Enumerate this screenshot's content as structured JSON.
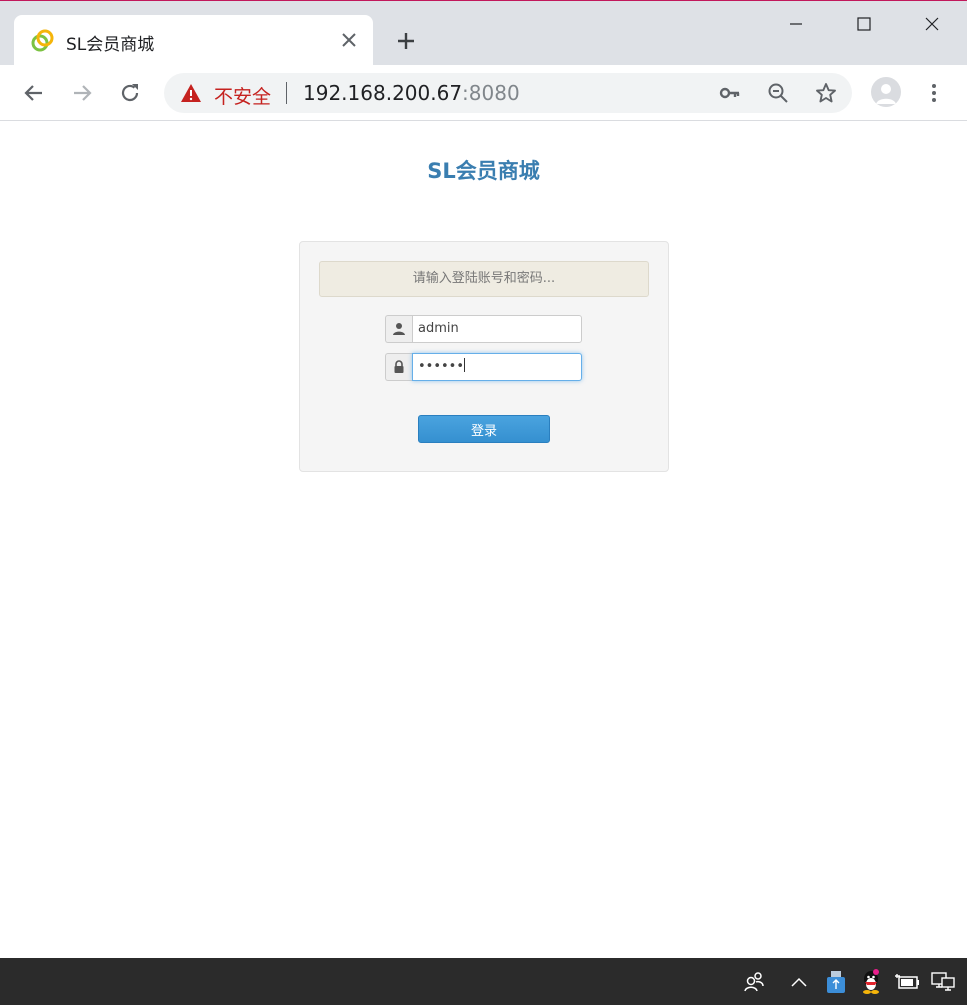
{
  "browser": {
    "tab": {
      "title": "SL会员商城",
      "favicon": "site-favicon-icon"
    },
    "address_bar": {
      "security_label": "不安全",
      "url_host": "192.168.200.67",
      "url_port": ":8080"
    },
    "icons": [
      "back-arrow-icon",
      "forward-arrow-icon",
      "reload-icon",
      "warning-icon",
      "key-icon",
      "zoom-out-icon",
      "star-icon",
      "avatar-icon",
      "more-vert-icon",
      "close-icon",
      "plus-icon",
      "minimize-icon",
      "maximize-icon"
    ],
    "colors": {
      "tabstrip": "#dee1e6",
      "insecure_red": "#c5221f"
    }
  },
  "page": {
    "title": "SL会员商城",
    "login": {
      "tip": "请输入登陆账号和密码...",
      "username_value": "admin",
      "password_masked": "••••••",
      "submit_label": "登录"
    },
    "colors": {
      "title": "#3a7eb0",
      "button": "#3590d0",
      "panel": "#f5f5f5",
      "tip_bg": "#efece2"
    }
  },
  "taskbar": {
    "icons": [
      "people-icon",
      "chevron-up-icon",
      "usb-icon",
      "qq-penguin-icon",
      "battery-plug-icon",
      "network-monitor-icon"
    ]
  }
}
